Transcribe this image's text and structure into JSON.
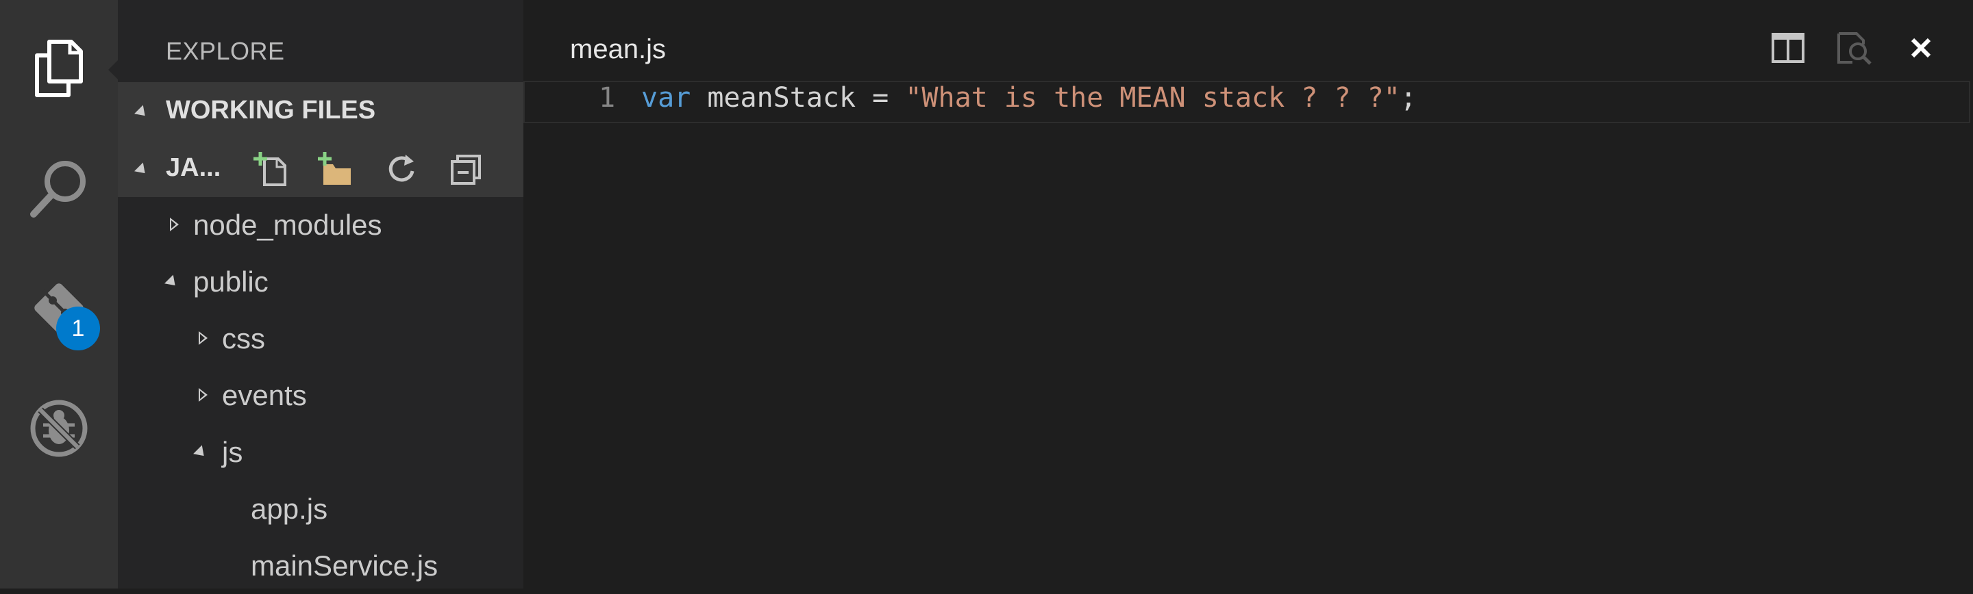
{
  "activity_bar": {
    "items": [
      {
        "name": "explorer",
        "icon": "files-icon"
      },
      {
        "name": "search",
        "icon": "search-icon"
      },
      {
        "name": "git",
        "icon": "git-icon",
        "badge": "1"
      },
      {
        "name": "debug",
        "icon": "debug-icon"
      }
    ]
  },
  "sidebar": {
    "title": "EXPLORE",
    "working_files_label": "WORKING FILES",
    "project_label": "JA...",
    "actions": [
      "new-file-icon",
      "new-folder-icon",
      "refresh-icon",
      "collapse-all-icon"
    ],
    "tree": [
      {
        "label": "node_modules",
        "type": "folder",
        "expanded": false
      },
      {
        "label": "public",
        "type": "folder",
        "expanded": true
      },
      {
        "label": "css",
        "type": "folder",
        "expanded": false
      },
      {
        "label": "events",
        "type": "folder",
        "expanded": false
      },
      {
        "label": "js",
        "type": "folder",
        "expanded": true
      },
      {
        "label": "app.js",
        "type": "file"
      },
      {
        "label": "mainService.js",
        "type": "file"
      }
    ]
  },
  "editor": {
    "title": "mean.js",
    "actions": [
      "split-editor-icon",
      "open-preview-icon",
      "close-icon"
    ],
    "lines": [
      {
        "number": "1",
        "tokens": [
          {
            "text": "var",
            "kind": "keyword"
          },
          {
            "text": " meanStack = ",
            "kind": "plain"
          },
          {
            "text": "\"What is the MEAN stack ? ? ?\"",
            "kind": "string"
          },
          {
            "text": ";",
            "kind": "plain"
          }
        ]
      }
    ]
  },
  "colors": {
    "activity_bar": "#333333",
    "sidebar": "#252526",
    "section_header": "#383838",
    "editor": "#1e1e1e",
    "keyword": "#569cd6",
    "string": "#ce9178",
    "badge": "#007acc"
  }
}
